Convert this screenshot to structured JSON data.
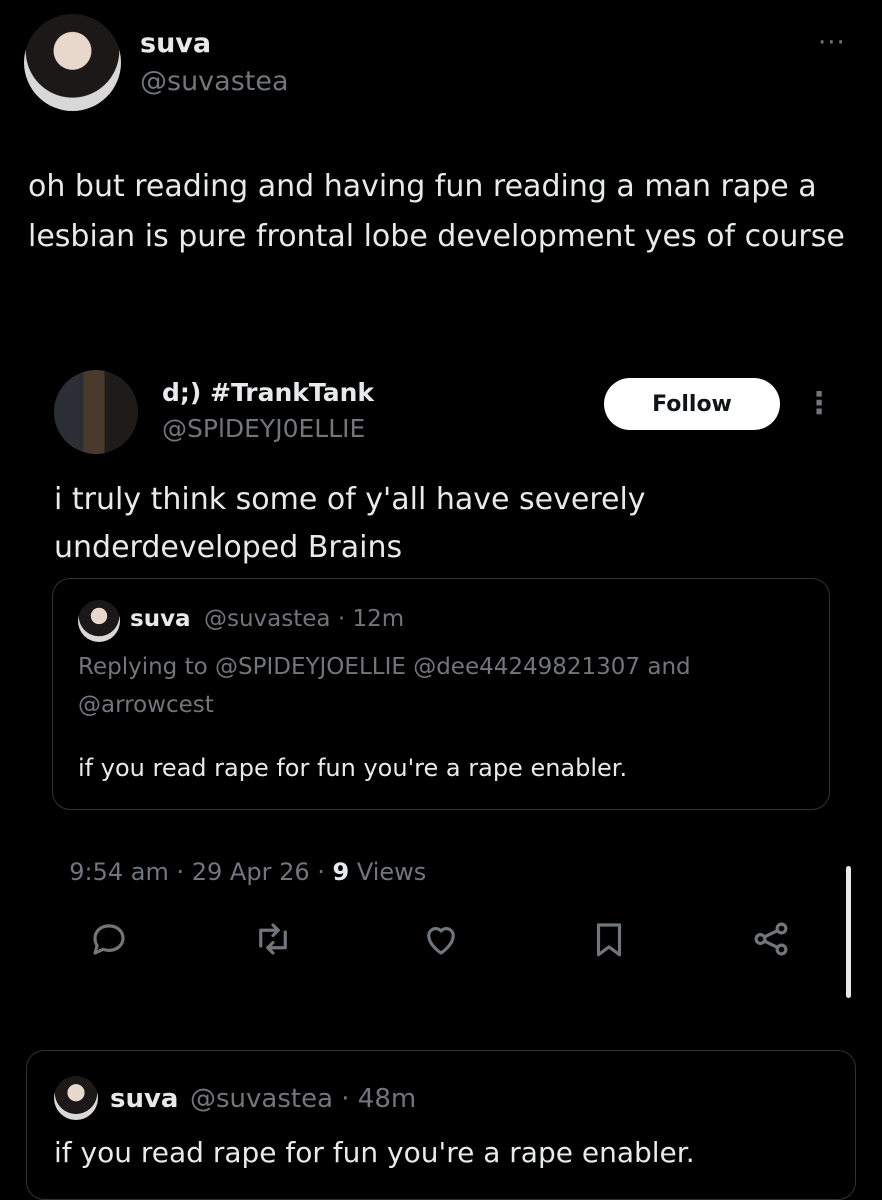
{
  "main_tweet": {
    "name": "suva",
    "handle": "@suvastea",
    "more": "···",
    "text": "oh but reading and having fun reading a man rape a lesbian is pure frontal lobe development yes of course"
  },
  "quoted_tweet": {
    "name": "d;) #TrankTank",
    "handle": "@SPlDEYJ0ELLIE",
    "follow_label": "Follow",
    "more": "⋮",
    "text": "i truly think some of y'all have severely underdeveloped Brains",
    "timestamp": "9:54 am · 29 Apr 26 · ",
    "views_count": "9",
    "views_label": " Views",
    "inner": {
      "name": "suva",
      "meta": "@suvastea · 12m",
      "replying": "Replying to @SPIDEYJOELLIE @dee44249821307 and @arrowcest",
      "text": "if you read rape for fun you're a rape enabler."
    }
  },
  "bottom_quote": {
    "name": "suva",
    "meta": "@suvastea · 48m",
    "text": "if you read rape for fun you're a rape enabler."
  }
}
